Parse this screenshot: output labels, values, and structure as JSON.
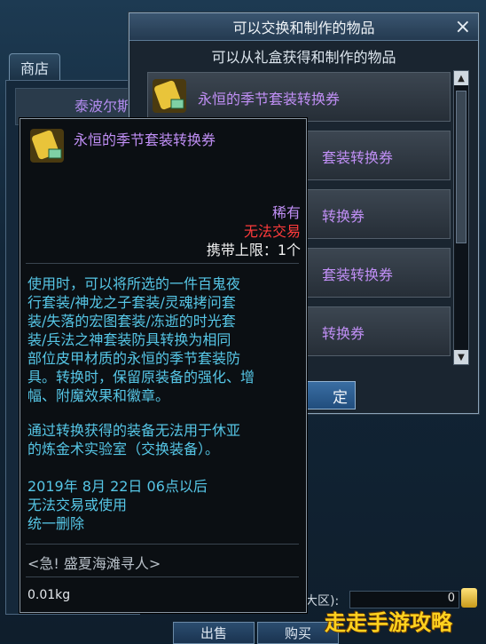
{
  "shop": {
    "tab_label": "商店",
    "first_item_name": "泰波尔斯",
    "currency_partial": "大区):",
    "gold_value": "0",
    "buttons": {
      "sell": "出售",
      "buy": "购买"
    }
  },
  "dialog": {
    "title": "可以交换和制作的物品",
    "close": "×",
    "subtitle": "可以从礼盒获得和制作的物品",
    "items": [
      {
        "label": "永恒的季节套装转换券"
      },
      {
        "label": "套装转换券"
      },
      {
        "label": "转换券"
      },
      {
        "label": "套装转换券"
      },
      {
        "label": "转换券"
      }
    ],
    "confirm_label": "定"
  },
  "tooltip": {
    "name": "永恒的季节套装转换券",
    "rarity": "稀有",
    "trade": "无法交易",
    "carry_limit": "携带上限：1个",
    "description": [
      "使用时，可以将所选的一件百鬼夜",
      "行套装/神龙之子套装/灵魂拷问套",
      "装/失落的宏图套装/冻逝的时光套",
      "装/兵法之神套装防具转换为相同",
      "部位皮甲材质的永恒的季节套装防",
      "具。转换时，保留原装备的强化、增",
      "幅、附魔效果和徽章。"
    ],
    "note": [
      "通过转换获得的装备无法用于休亚",
      "的炼金术实验室（交换装备）。"
    ],
    "expiry": [
      "2019年 8月 22日 06点以后",
      "无法交易或使用",
      "统一删除"
    ],
    "source": "<急! 盛夏海滩寻人>",
    "weight": "0.01kg"
  },
  "watermark": "走走手游攻略",
  "colors": {
    "rare": "#c08ff5",
    "untradeable": "#ff3b3b",
    "desc": "#56c6e6"
  }
}
